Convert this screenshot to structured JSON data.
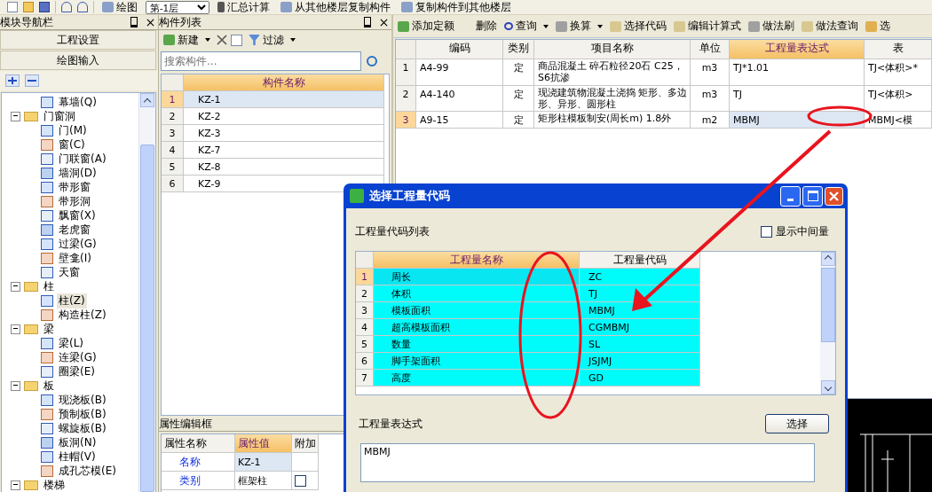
{
  "top_toolbar": {
    "items": [
      {
        "kind": "draw",
        "label": "绘图"
      },
      {
        "kind": "floor",
        "value": "第-1层"
      },
      {
        "kind": "sum",
        "label": "汇总计算"
      },
      {
        "kind": "copy_from",
        "label": "从其他楼层复制构件"
      },
      {
        "kind": "copy_to",
        "label": "复制构件到其他楼层"
      }
    ]
  },
  "nav_panel": {
    "title": "模块导航栏",
    "sections": [
      "工程设置",
      "绘图输入"
    ],
    "tree": [
      {
        "children": [
          {
            "label": "幕墙(Q)",
            "selected": false
          }
        ]
      },
      {
        "label": "门窗洞",
        "expanded": true,
        "children": [
          {
            "label": "门(M)",
            "selected": false
          },
          {
            "label": "窗(C)",
            "selected": false
          },
          {
            "label": "门联窗(A)",
            "selected": false
          },
          {
            "label": "墙洞(D)",
            "selected": false
          },
          {
            "label": "带形窗",
            "selected": false
          },
          {
            "label": "带形洞",
            "selected": false
          },
          {
            "label": "飘窗(X)",
            "selected": false
          },
          {
            "label": "老虎窗",
            "selected": false
          },
          {
            "label": "过梁(G)",
            "selected": false
          },
          {
            "label": "壁龛(I)",
            "selected": false
          },
          {
            "label": "天窗",
            "selected": false
          }
        ]
      },
      {
        "label": "柱",
        "expanded": true,
        "children": [
          {
            "label": "柱(Z)",
            "selected": true
          },
          {
            "label": "构造柱(Z)",
            "selected": false
          }
        ]
      },
      {
        "label": "梁",
        "expanded": true,
        "children": [
          {
            "label": "梁(L)",
            "selected": false
          },
          {
            "label": "连梁(G)",
            "selected": false
          },
          {
            "label": "圈梁(E)",
            "selected": false
          }
        ]
      },
      {
        "label": "板",
        "expanded": true,
        "children": [
          {
            "label": "现浇板(B)",
            "selected": false
          },
          {
            "label": "预制板(B)",
            "selected": false
          },
          {
            "label": "螺旋板(B)",
            "selected": false
          },
          {
            "label": "板洞(N)",
            "selected": false
          },
          {
            "label": "柱帽(V)",
            "selected": false
          },
          {
            "label": "成孔芯模(E)",
            "selected": false
          }
        ]
      },
      {
        "label": "楼梯",
        "expanded": true
      }
    ]
  },
  "component_panel": {
    "title": "构件列表",
    "toolbar": [
      {
        "kind": "new",
        "label": "新建"
      },
      {
        "kind": "delete"
      },
      {
        "kind": "copy"
      },
      {
        "kind": "filter",
        "label": "过滤"
      }
    ],
    "search": {
      "placeholder": "搜索构件..."
    },
    "columns": [
      "构件名称"
    ],
    "rows": [
      {
        "num": "1",
        "name": "KZ-1",
        "selected": true
      },
      {
        "num": "2",
        "name": "KZ-2",
        "selected": false
      },
      {
        "num": "3",
        "name": "KZ-3",
        "selected": false
      },
      {
        "num": "4",
        "name": "KZ-7",
        "selected": false
      },
      {
        "num": "5",
        "name": "KZ-8",
        "selected": false
      },
      {
        "num": "6",
        "name": "KZ-9",
        "selected": false
      }
    ]
  },
  "property_panel": {
    "title": "属性编辑框",
    "columns": [
      "属性名称",
      "属性值",
      "附加"
    ],
    "rows": [
      {
        "kind": "text",
        "name": "名称",
        "value": "KZ-1",
        "selected": true
      },
      {
        "kind": "checkbox",
        "name": "类别",
        "value": "框架柱",
        "checked": false,
        "selected": false
      }
    ]
  },
  "quota_panel": {
    "toolbar": [
      {
        "kind": "add",
        "label": "添加定额",
        "dropdown": false
      },
      {
        "kind": "delete",
        "label": "删除",
        "dropdown": false
      },
      {
        "kind": "search",
        "label": "查询",
        "dropdown": true
      },
      {
        "kind": "fx",
        "label": "换算",
        "dropdown": true
      },
      {
        "kind": "code",
        "label": "选择代码",
        "dropdown": false
      },
      {
        "kind": "keyboard",
        "label": "编辑计算式",
        "dropdown": false
      },
      {
        "kind": "brush",
        "label": "做法刷",
        "dropdown": false
      },
      {
        "kind": "lookup",
        "label": "做法查询",
        "dropdown": false
      },
      {
        "kind": "paste",
        "label": "选",
        "dropdown": false
      }
    ],
    "columns": [
      {
        "label": "编码",
        "selected": false
      },
      {
        "label": "类别",
        "selected": false
      },
      {
        "label": "项目名称",
        "selected": false
      },
      {
        "label": "单位",
        "selected": false
      },
      {
        "label": "工程量表达式",
        "selected": true
      },
      {
        "label": "表",
        "selected": false
      }
    ],
    "rows": [
      {
        "num": "1",
        "code": "A4-99",
        "type": "定",
        "name": "商品混凝土 碎石粒径20石 C25，S6抗渗",
        "unit": "m3",
        "expr": "TJ*1.01",
        "expr_desc": "TJ<体积>*",
        "selected": false
      },
      {
        "num": "2",
        "code": "A4-140",
        "type": "定",
        "name": "现浇建筑物混凝土浇捣 矩形、多边形、异形、圆形柱",
        "unit": "m3",
        "expr": "TJ",
        "expr_desc": "TJ<体积>",
        "selected": false
      },
      {
        "num": "3",
        "code": "A9-15",
        "type": "定",
        "name": "矩形柱模板制安(周长m) 1.8外",
        "unit": "m2",
        "expr": "MBMJ",
        "expr_desc": "MBMJ<模",
        "selected": true
      }
    ]
  },
  "dialog": {
    "title": "选择工程量代码",
    "list_label": "工程量代码列表",
    "show_intermediate": {
      "label": "显示中间量",
      "checked": false
    },
    "columns": [
      "工程量名称",
      "工程量代码"
    ],
    "rows": [
      {
        "num": "1",
        "name": "周长",
        "code": "ZC",
        "selected": true
      },
      {
        "num": "2",
        "name": "体积",
        "code": "TJ",
        "selected": false
      },
      {
        "num": "3",
        "name": "模板面积",
        "code": "MBMJ",
        "selected": false
      },
      {
        "num": "4",
        "name": "超高模板面积",
        "code": "CGMBMJ",
        "selected": false
      },
      {
        "num": "5",
        "name": "数量",
        "code": "SL",
        "selected": false
      },
      {
        "num": "6",
        "name": "脚手架面积",
        "code": "JSJMJ",
        "selected": false
      },
      {
        "num": "7",
        "name": "高度",
        "code": "GD",
        "selected": false
      }
    ],
    "expr_label": "工程量表达式",
    "select_button": "选择",
    "expr_value": "MBMJ"
  },
  "annotations": [
    {
      "kind": "ellipse"
    },
    {
      "kind": "ellipse"
    },
    {
      "kind": "arrow"
    }
  ]
}
